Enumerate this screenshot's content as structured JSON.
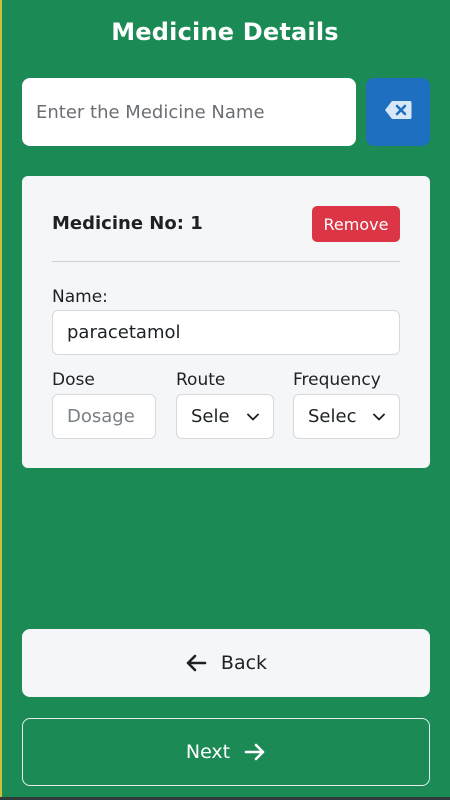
{
  "header": {
    "title": "Medicine Details"
  },
  "search": {
    "placeholder": "Enter the Medicine Name",
    "value": ""
  },
  "clear_button": {
    "icon": "backspace-icon"
  },
  "medicine_card": {
    "title": "Medicine No: 1",
    "remove_label": "Remove",
    "name_label": "Name:",
    "name_value": "paracetamol",
    "dose_label": "Dose",
    "dose_placeholder": "Dosage",
    "route_label": "Route",
    "route_value": "Sele",
    "frequency_label": "Frequency",
    "frequency_value": "Selec"
  },
  "nav": {
    "back_label": "Back",
    "next_label": "Next"
  },
  "colors": {
    "background": "#1b8a55",
    "clear_button": "#1e6fc0",
    "remove_button": "#dc3545",
    "card": "#f5f6f8"
  }
}
